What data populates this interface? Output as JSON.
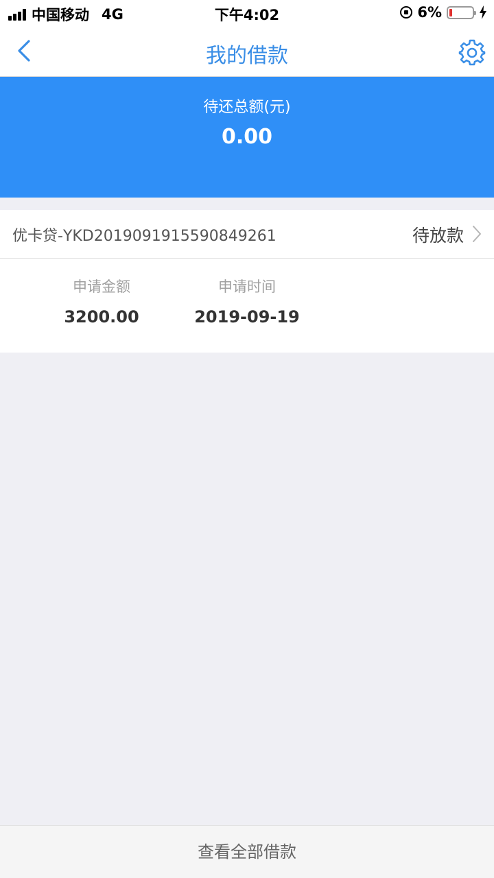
{
  "status_bar": {
    "carrier": "中国移动",
    "network": "4G",
    "time": "下午4:02",
    "battery": "6%"
  },
  "nav": {
    "title": "我的借款",
    "back_icon": "chevron-left-icon",
    "settings_icon": "gear-icon"
  },
  "summary": {
    "label": "待还总额(元)",
    "amount": "0.00"
  },
  "loan": {
    "id": "优卡贷-YKD2019091915590849261",
    "status": "待放款",
    "fields": [
      {
        "label": "申请金额",
        "value": "3200.00"
      },
      {
        "label": "申请时间",
        "value": "2019-09-19"
      }
    ]
  },
  "footer": {
    "view_all_label": "查看全部借款"
  },
  "colors": {
    "accent": "#3a8ee6",
    "banner": "#2f8ff7",
    "background": "#efeff4"
  }
}
